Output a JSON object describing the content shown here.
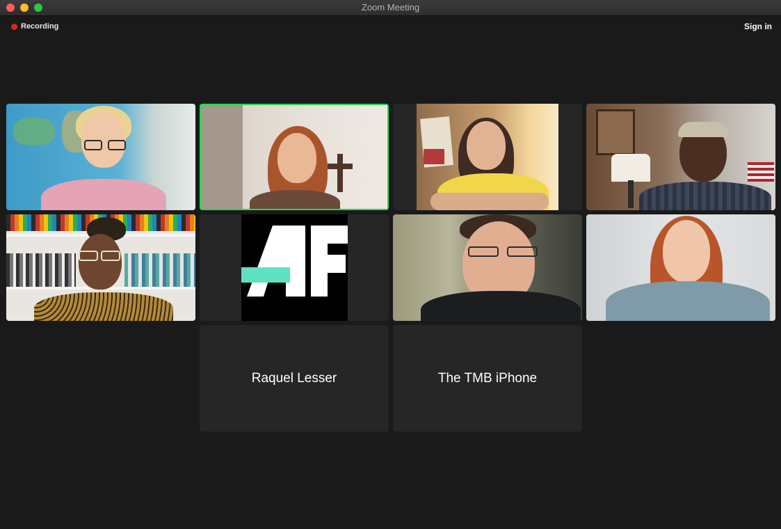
{
  "window": {
    "title": "Zoom Meeting"
  },
  "recording": {
    "label": "Recording"
  },
  "header": {
    "sign_in": "Sign in"
  },
  "participants": [
    {
      "type": "video",
      "desc": "woman with glasses, world map background"
    },
    {
      "type": "video",
      "desc": "woman with red hair, cross on wall",
      "active_speaker": true
    },
    {
      "type": "video",
      "desc": "woman with posters in background"
    },
    {
      "type": "video",
      "desc": "man with cap, office background"
    },
    {
      "type": "video",
      "desc": "woman with glasses, bookshelf background"
    },
    {
      "type": "logo",
      "desc": "AF logo"
    },
    {
      "type": "video",
      "desc": "man with glasses, dark hoodie"
    },
    {
      "type": "video",
      "desc": "woman with long hair, grey sweater"
    },
    {
      "type": "name",
      "name": "Raquel Lesser"
    },
    {
      "type": "name",
      "name": "The TMB iPhone"
    }
  ],
  "colors": {
    "active_border": "#23d952",
    "recording_dot": "#e5231b",
    "logo_bar": "#5fe1c3"
  }
}
